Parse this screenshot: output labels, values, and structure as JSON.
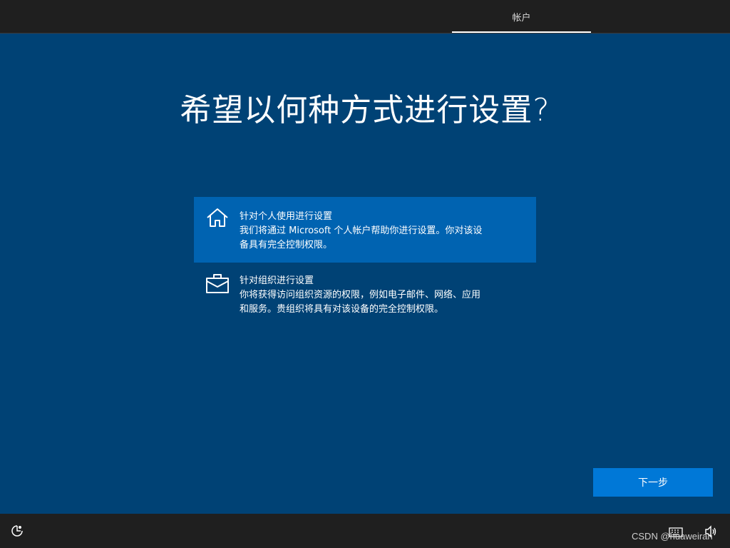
{
  "header": {
    "tab_label": "帐户"
  },
  "main": {
    "title": "希望以何种方式进行设置?"
  },
  "options": [
    {
      "icon": "home-icon",
      "title": "针对个人使用进行设置",
      "desc_line1": "我们将通过 Microsoft 个人帐户帮助你进行设置。你对该设",
      "desc_line2": "备具有完全控制权限。",
      "selected": true
    },
    {
      "icon": "briefcase-icon",
      "title": "针对组织进行设置",
      "desc_line1": "你将获得访问组织资源的权限，例如电子邮件、网络、应用",
      "desc_line2": "和服务。贵组织将具有对该设备的完全控制权限。",
      "selected": false
    }
  ],
  "footer": {
    "next_label": "下一步",
    "watermark": "CSDN @huaweiran",
    "ease_icon": "ease-of-access-icon",
    "keyboard_icon": "keyboard-icon",
    "volume_icon": "volume-icon"
  },
  "colors": {
    "background": "#004275",
    "bars": "#1f1f1f",
    "selected_option": "#0063b1",
    "accent_button": "#0078d7"
  }
}
